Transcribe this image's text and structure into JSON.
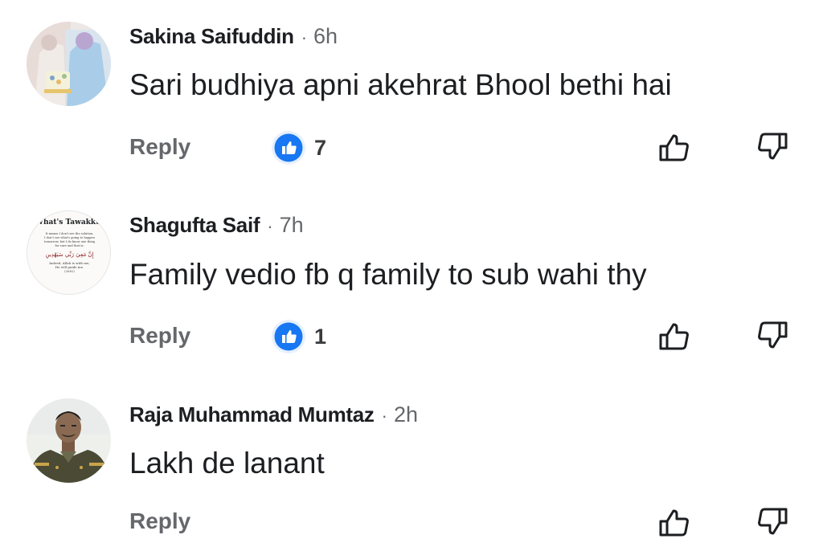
{
  "comments": [
    {
      "author": "Sakina Saifuddin",
      "separator": "·",
      "time": "6h",
      "text": "Sari budhiya apni akehrat Bhool bethi hai",
      "reply_label": "Reply",
      "like_count": "7"
    },
    {
      "author": "Shagufta Saif",
      "separator": "·",
      "time": "7h",
      "text": "Family vedio fb q family to sub wahi thy",
      "reply_label": "Reply",
      "like_count": "1",
      "avatar_text": {
        "title": "What's Tawakkul",
        "line1": "It means I don't see the solution,",
        "line2": "I don't see what's going to happen",
        "line3": "tomorrow, but I do know one thing",
        "line4": "for sure and that is:",
        "arabic": "إِنَّ مَعِيَ رَبِّي سَيَهْدِينِ",
        "line5": "Indeed, Allah is with me;",
        "line6": "He will guide me.",
        "line7": "(26:62)"
      }
    },
    {
      "author": "Raja Muhammad Mumtaz",
      "separator": "·",
      "time": "2h",
      "text": "Lakh de lanant",
      "reply_label": "Reply"
    }
  ],
  "icons": {
    "reaction": "like-reaction-icon",
    "like": "thumbs-up-outline-icon",
    "dislike": "thumbs-down-outline-icon"
  },
  "colors": {
    "accent_blue": "#1877f2",
    "secondary_text": "#65676b",
    "primary_text": "#1c1e21"
  }
}
